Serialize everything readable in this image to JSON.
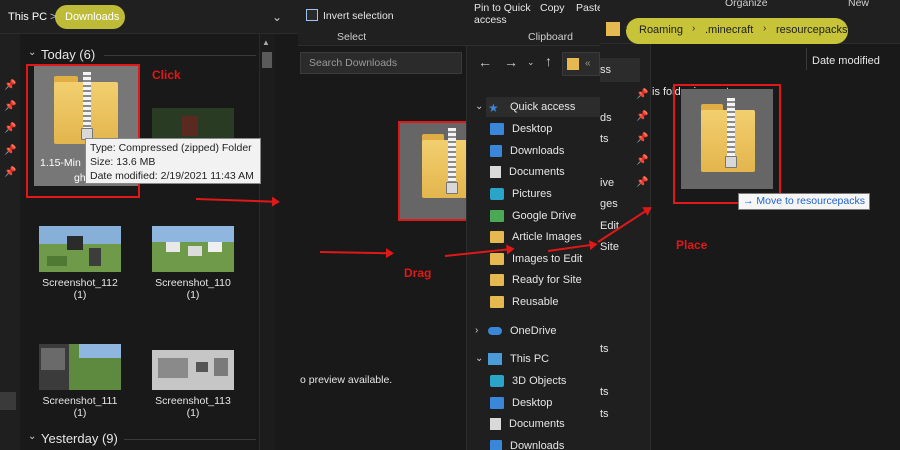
{
  "left_pane": {
    "breadcrumb": {
      "root": "This PC",
      "sep": ">",
      "current": "Downloads"
    },
    "groups": [
      {
        "label": "Today (6)"
      },
      {
        "label": "Yesterday (9)"
      }
    ],
    "files": [
      {
        "name": "1.15-Min"
      },
      {
        "name": "Screenshot_112",
        "sub": "(1)"
      },
      {
        "name": "Screenshot_110",
        "sub": "(1)"
      },
      {
        "name": "Screenshot_111",
        "sub": "(1)"
      },
      {
        "name": "Screenshot_113",
        "sub": "(1)"
      }
    ],
    "tooltip": {
      "type": "Type: Compressed (zipped) Folder",
      "size": "Size: 13.6 MB",
      "date": "Date modified: 2/19/2021 11:43 AM"
    },
    "name_fragment": "gh"
  },
  "annotations": {
    "click": "Click",
    "drag": "Drag",
    "place": "Place"
  },
  "middle_pane": {
    "ribbon_item": "Invert selection",
    "ribbon_group": "Select",
    "search_placeholder": "Search Downloads",
    "no_preview": "o preview available."
  },
  "nav_pane": {
    "ribbon": {
      "pin": "Pin to Quick access",
      "copy": "Copy",
      "paste": "Paste",
      "group": "Clipboard"
    },
    "items": [
      {
        "label": "Quick access",
        "icon": "star-icon"
      },
      {
        "label": "Desktop",
        "icon": "desktop-icon"
      },
      {
        "label": "Downloads",
        "icon": "download-icon"
      },
      {
        "label": "Documents",
        "icon": "documents-icon"
      },
      {
        "label": "Pictures",
        "icon": "pictures-icon"
      },
      {
        "label": "Google Drive",
        "icon": "google-drive-icon"
      },
      {
        "label": "Article Images",
        "icon": "folder-icon"
      },
      {
        "label": "Images to Edit",
        "icon": "folder-icon"
      },
      {
        "label": "Ready for Site",
        "icon": "folder-icon"
      },
      {
        "label": "Reusable",
        "icon": "folder-icon"
      },
      {
        "label": "OneDrive",
        "icon": "onedrive-icon"
      },
      {
        "label": "This PC",
        "icon": "pc-icon"
      },
      {
        "label": "3D Objects",
        "icon": "3d-objects-icon"
      },
      {
        "label": "Desktop",
        "icon": "desktop-icon"
      },
      {
        "label": "Documents",
        "icon": "documents-icon"
      },
      {
        "label": "Downloads",
        "icon": "download-icon"
      }
    ]
  },
  "resource_pane": {
    "ribbon": {
      "organize": "Organize",
      "new": "New"
    },
    "breadcrumb": [
      "Roaming",
      ".minecraft",
      "resourcepacks"
    ],
    "column": "Date modified",
    "empty_msg": "is folder is empty.",
    "move_tip": "Move to resourcepacks",
    "side_fragments": [
      "ds",
      "ts",
      "ive",
      "ges",
      "Edit",
      "Site",
      "ts",
      "ts",
      "ts"
    ]
  },
  "colors": {
    "highlight": "#c7c43a",
    "annotation": "#e01818",
    "accent": "#3a86d8"
  }
}
